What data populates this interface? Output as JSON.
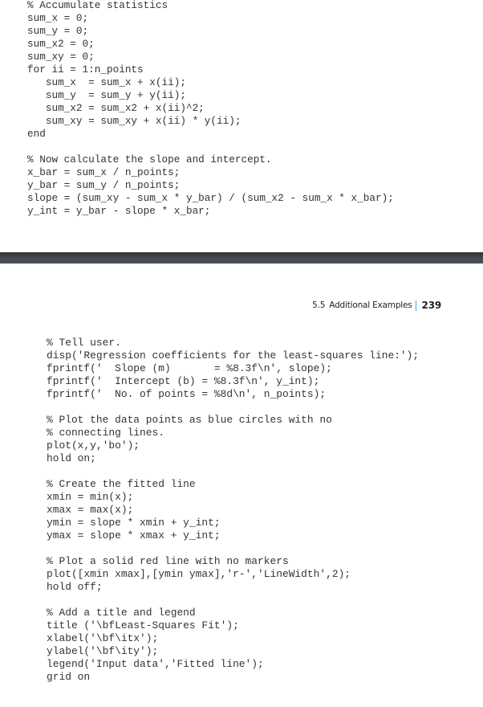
{
  "top_page": {
    "code_lines": [
      "% Accumulate statistics",
      "sum_x = 0;",
      "sum_y = 0;",
      "sum_x2 = 0;",
      "sum_xy = 0;",
      "for ii = 1:n_points",
      "   sum_x  = sum_x + x(ii);",
      "   sum_y  = sum_y + y(ii);",
      "   sum_x2 = sum_x2 + x(ii)^2;",
      "   sum_xy = sum_xy + x(ii) * y(ii);",
      "end",
      "",
      "% Now calculate the slope and intercept.",
      "x_bar = sum_x / n_points;",
      "y_bar = sum_y / n_points;",
      "slope = (sum_xy - sum_x * y_bar) / (sum_x2 - sum_x * x_bar);",
      "y_int = y_bar - slope * x_bar;"
    ]
  },
  "bottom_page": {
    "running_head": {
      "section": "5.5",
      "title": "Additional Examples",
      "page_number": "239"
    },
    "code_lines": [
      "% Tell user.",
      "disp('Regression coefficients for the least-squares line:');",
      "fprintf('  Slope (m)       = %8.3f\\n', slope);",
      "fprintf('  Intercept (b) = %8.3f\\n', y_int);",
      "fprintf('  No. of points = %8d\\n', n_points);",
      "",
      "% Plot the data points as blue circles with no",
      "% connecting lines.",
      "plot(x,y,'bo');",
      "hold on;",
      "",
      "% Create the fitted line",
      "xmin = min(x);",
      "xmax = max(x);",
      "ymin = slope * xmin + y_int;",
      "ymax = slope * xmax + y_int;",
      "",
      "% Plot a solid red line with no markers",
      "plot([xmin xmax],[ymin ymax],'r-','LineWidth',2);",
      "hold off;",
      "",
      "% Add a title and legend",
      "title ('\\bfLeast-Squares Fit');",
      "xlabel('\\bf\\itx');",
      "ylabel('\\bf\\ity');",
      "legend('Input data','Fitted line');",
      "grid on"
    ]
  },
  "colors": {
    "divider": "#43474b",
    "running_head_separator": "#3aa7d9",
    "code_text": "#333333"
  }
}
